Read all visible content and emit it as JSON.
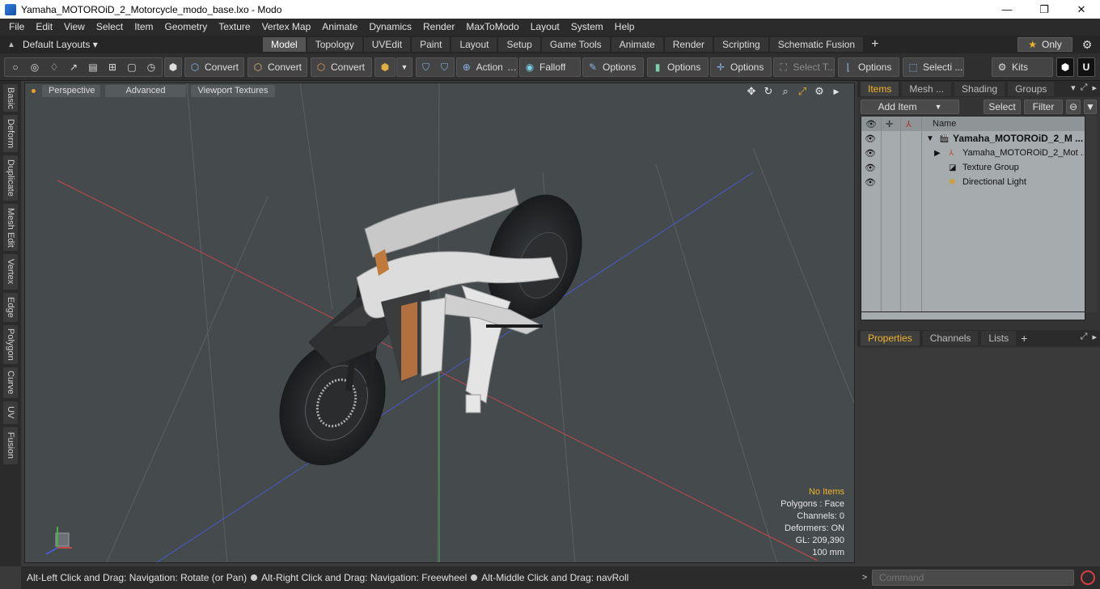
{
  "window": {
    "title": "Yamaha_MOTOROiD_2_Motorcycle_modo_base.lxo - Modo",
    "minimize": "—",
    "maximize": "❐",
    "close": "✕"
  },
  "menu": [
    "File",
    "Edit",
    "View",
    "Select",
    "Item",
    "Geometry",
    "Texture",
    "Vertex Map",
    "Animate",
    "Dynamics",
    "Render",
    "MaxToModo",
    "Layout",
    "System",
    "Help"
  ],
  "layout_selector": "Default Layouts ▾",
  "layout_tabs": [
    "Model",
    "Topology",
    "UVEdit",
    "Paint",
    "Layout",
    "Setup",
    "Game Tools",
    "Animate",
    "Render",
    "Scripting",
    "Schematic Fusion"
  ],
  "active_layout_tab": "Model",
  "only_label": "Only",
  "toolbar": {
    "convert1": "Convert",
    "convert2": "Convert",
    "convert3": "Convert",
    "action": "Action",
    "falloff": "Falloff",
    "options1": "Options",
    "options2": "Options",
    "options3": "Options",
    "select_t": "Select T...",
    "options4": "Options",
    "selecti": "Selecti ...",
    "kits": "Kits"
  },
  "left_tabs": [
    "Basic",
    "Deform",
    "Duplicate",
    "Mesh Edit",
    "Vertex",
    "Edge",
    "Polygon",
    "Curve",
    "UV",
    "Fusion"
  ],
  "viewport": {
    "perspective": "Perspective",
    "advanced": "Advanced",
    "textures": "Viewport Textures",
    "stats": {
      "no_items": "No Items",
      "polygons": "Polygons : Face",
      "channels": "Channels: 0",
      "deformers": "Deformers: ON",
      "gl": "GL: 209,390",
      "units": "100 mm"
    }
  },
  "status": {
    "part1": "Alt-Left Click and Drag: Navigation: Rotate (or Pan)",
    "part2": "Alt-Right Click and Drag: Navigation: Freewheel",
    "part3": "Alt-Middle Click and Drag: navRoll"
  },
  "items_panel": {
    "tabs": [
      "Items",
      "Mesh ...",
      "Shading",
      "Groups"
    ],
    "add_item": "Add Item",
    "select": "Select",
    "filter": "Filter",
    "col_name": "Name",
    "rows": [
      {
        "name": "Yamaha_MOTOROiD_2_M ...",
        "icon": "scene-icon"
      },
      {
        "name": "Yamaha_MOTOROiD_2_Mot ...",
        "icon": "mesh-icon"
      },
      {
        "name": "Texture Group",
        "icon": "texture-group-icon"
      },
      {
        "name": "Directional Light",
        "icon": "light-icon"
      }
    ]
  },
  "properties_panel": {
    "tabs": [
      "Properties",
      "Channels",
      "Lists"
    ]
  },
  "command": {
    "placeholder": "Command"
  }
}
